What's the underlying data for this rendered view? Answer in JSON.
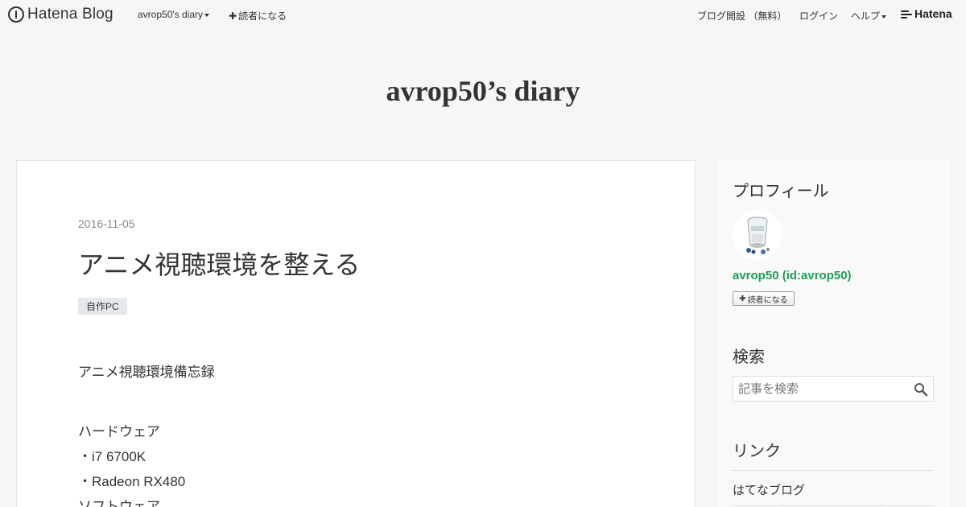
{
  "topbar": {
    "logo_text": "Hatena Blog",
    "blog_menu_label": "avrop50's diary",
    "subscribe_label": "読者になる",
    "open_blog_label": "ブログ開設 （無料）",
    "login_label": "ログイン",
    "help_label": "ヘルプ",
    "brand_label": "Hatena"
  },
  "header": {
    "blog_title": "avrop50’s diary"
  },
  "entry": {
    "date": "2016-11-05",
    "title": "アニメ視聴環境を整える",
    "category": "自作PC",
    "body": [
      "アニメ視聴環境備忘録",
      "ハードウェア",
      "・i7 6700K",
      "・Radeon RX480",
      "ソフトウェア"
    ]
  },
  "sidebar": {
    "profile_heading": "プロフィール",
    "profile_name": "avrop50 (id:avrop50)",
    "subscribe_button_label": "読者になる",
    "search_heading": "検索",
    "search_placeholder": "記事を検索",
    "links_heading": "リンク",
    "links": [
      "はてなブログ"
    ]
  },
  "colors": {
    "accent_green": "#1f9d55",
    "page_background": "#f6f6f6"
  }
}
